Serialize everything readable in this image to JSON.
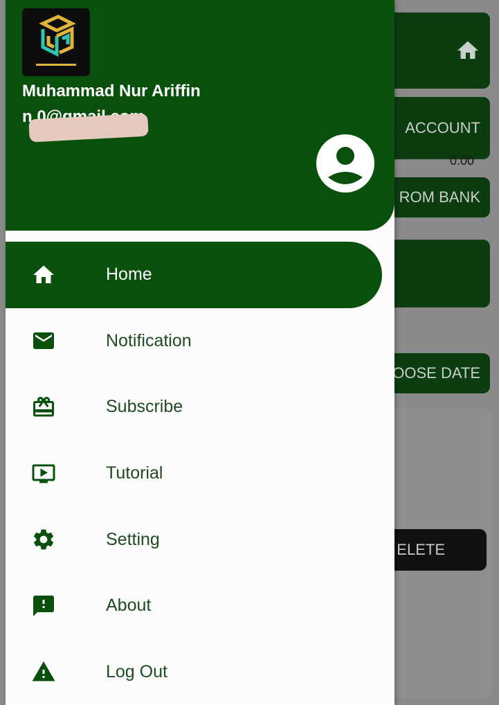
{
  "background": {
    "cards": [
      "ACCOUNT",
      "ROM BANK",
      "OOSE DATE"
    ],
    "small_value": "0.00",
    "delete_label": "ELETE"
  },
  "drawer": {
    "header": {
      "user_name": "Muhammad Nur Ariffin",
      "user_email": "n              0@gmail.com",
      "accent_color": "#0a500d"
    },
    "menu": [
      {
        "label": "Home",
        "icon": "home-icon",
        "active": true
      },
      {
        "label": "Notification",
        "icon": "mail-icon"
      },
      {
        "label": "Subscribe",
        "icon": "card-giftcard-icon"
      },
      {
        "label": "Tutorial",
        "icon": "play-screen-icon"
      },
      {
        "label": "Setting",
        "icon": "gear-icon"
      },
      {
        "label": "About",
        "icon": "feedback-icon"
      },
      {
        "label": "Log Out",
        "icon": "warning-icon"
      }
    ]
  }
}
